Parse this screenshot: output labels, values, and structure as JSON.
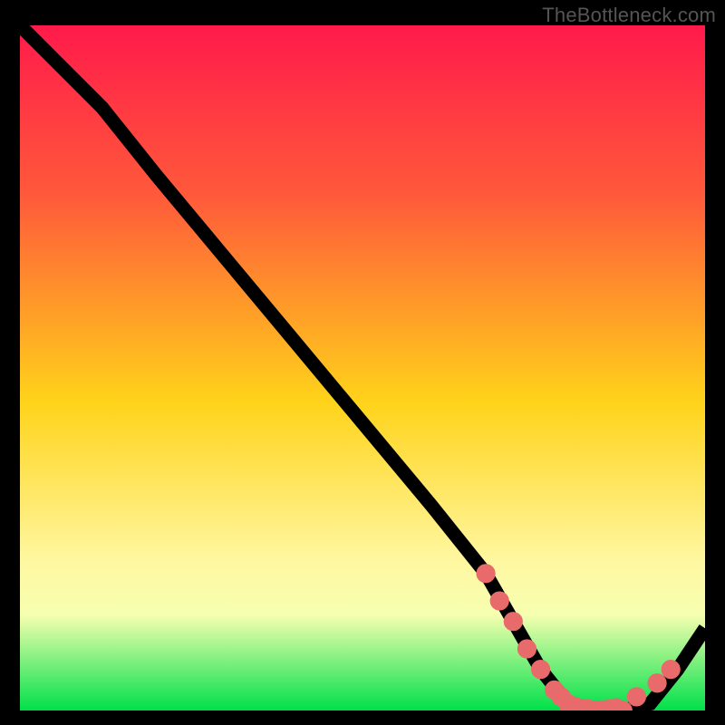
{
  "watermark": "TheBottleneck.com",
  "colors": {
    "background": "#000000",
    "gradient_stops": [
      "#ff1a4b",
      "#ff5a3a",
      "#ffd31a",
      "#fff7a0",
      "#f6ffb0",
      "#00e04a"
    ],
    "curve": "#000000",
    "dots": "#e86a6a"
  },
  "chart_data": {
    "type": "line",
    "title": "",
    "xlabel": "",
    "ylabel": "",
    "xlim": [
      0,
      100
    ],
    "ylim": [
      0,
      100
    ],
    "grid": false,
    "legend": false,
    "series": [
      {
        "name": "bottleneck-curve",
        "x": [
          0,
          8,
          12,
          20,
          30,
          40,
          50,
          60,
          68,
          72,
          76,
          80,
          84,
          88,
          92,
          96,
          100
        ],
        "y": [
          100,
          92,
          88,
          78,
          66,
          54,
          42,
          30,
          20,
          13,
          6,
          1,
          0,
          0,
          1,
          6,
          12
        ]
      }
    ],
    "scatter": [
      {
        "name": "highlight-dots",
        "x": [
          68,
          70,
          72,
          74,
          76,
          78,
          79,
          80,
          81,
          82,
          83,
          84,
          85,
          86,
          87,
          88,
          90,
          93,
          95
        ],
        "y": [
          20,
          16,
          13,
          9,
          6,
          3,
          2,
          1,
          0.6,
          0.3,
          0.2,
          0,
          0.1,
          0.2,
          0.4,
          0,
          2,
          4,
          6
        ]
      }
    ]
  }
}
